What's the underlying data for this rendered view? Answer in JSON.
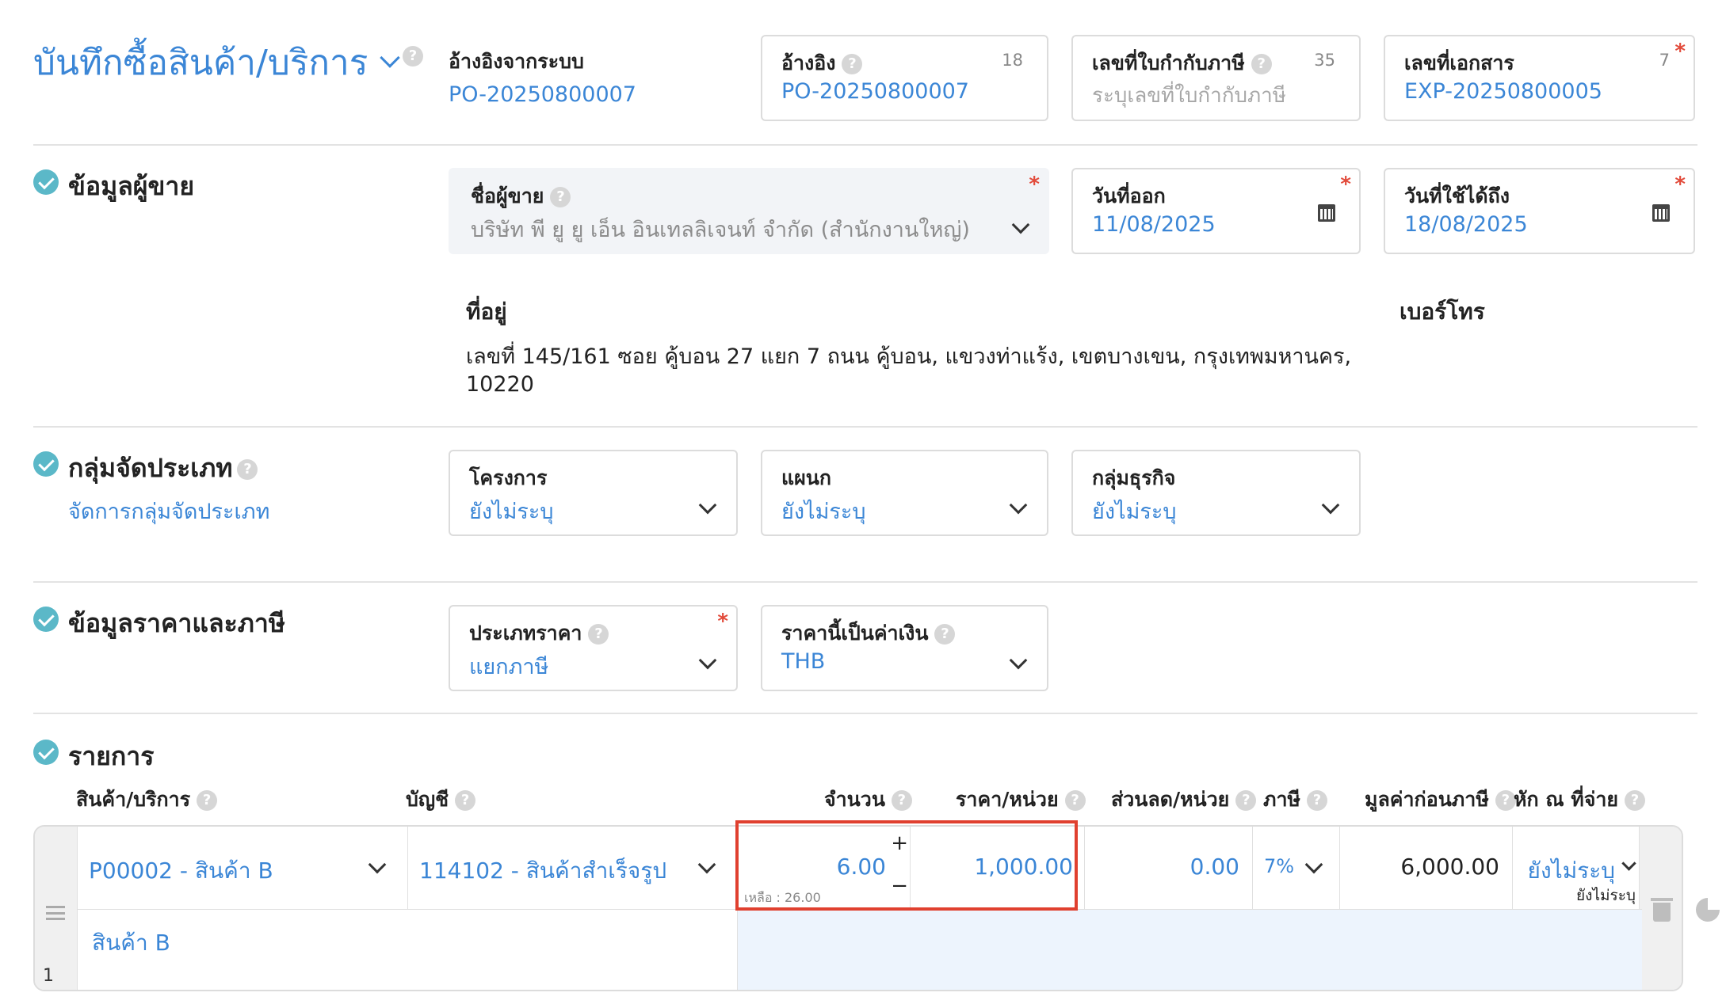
{
  "header": {
    "title": "บันทึกซื้อสินค้า/บริการ",
    "help": "?",
    "ref_system_label": "อ้างอิงจากระบบ",
    "ref_system_value": "PO-20250800007",
    "ref": {
      "label": "อ้างอิง",
      "value": "PO-20250800007",
      "count": "18"
    },
    "tax_invoice": {
      "label": "เลขที่ใบกำกับภาษี",
      "placeholder": "ระบุเลขที่ใบกำกับภาษี",
      "count": "35"
    },
    "doc_no": {
      "label": "เลขที่เอกสาร",
      "value": "EXP-20250800005",
      "count": "7",
      "required": "*"
    }
  },
  "vendor_section": {
    "title": "ข้อมูลผู้ขาย",
    "vendor_name": {
      "label": "ชื่อผู้ขาย",
      "value": "บริษัท พี ยู ยู เอ็น อินเทลลิเจนท์ จำกัด (สำนักงานใหญ่)",
      "required": "*"
    },
    "issue_date": {
      "label": "วันที่ออก",
      "value": "11/08/2025",
      "required": "*"
    },
    "valid_until": {
      "label": "วันที่ใช้ได้ถึง",
      "value": "18/08/2025",
      "required": "*"
    },
    "address_label": "ที่อยู่",
    "address_line1": "เลขที่ 145/161 ซอย คู้บอน 27 แยก 7 ถนน คู้บอน, แขวงท่าแร้ง, เขตบางเขน, กรุงเทพมหานคร,",
    "address_line2": "10220",
    "phone_label": "เบอร์โทร"
  },
  "category_section": {
    "title": "กลุ่มจัดประเภท",
    "manage_link": "จัดการกลุ่มจัดประเภท",
    "project": {
      "label": "โครงการ",
      "value": "ยังไม่ระบุ"
    },
    "department": {
      "label": "แผนก",
      "value": "ยังไม่ระบุ"
    },
    "business_group": {
      "label": "กลุ่มธุรกิจ",
      "value": "ยังไม่ระบุ"
    }
  },
  "price_section": {
    "title": "ข้อมูลราคาและภาษี",
    "price_type": {
      "label": "ประเภทราคา",
      "value": "แยกภาษี",
      "required": "*"
    },
    "currency": {
      "label": "ราคานี้เป็นค่าเงิน",
      "value": "THB"
    }
  },
  "items_section": {
    "title": "รายการ",
    "columns": {
      "product": "สินค้า/บริการ",
      "account": "บัญชี",
      "qty": "จำนวน",
      "unit_price": "ราคา/หน่วย",
      "discount": "ส่วนลด/หน่วย",
      "tax": "ภาษี",
      "pre_tax": "มูลค่าก่อนภาษี",
      "withholding": "หัก ณ ที่จ่าย"
    },
    "rows": [
      {
        "index": "1",
        "product": "P00002 - สินค้า B",
        "account": "114102 - สินค้าสำเร็จรูป",
        "qty": "6.00",
        "remaining": "เหลือ : 26.00",
        "unit_price": "1,000.00",
        "discount": "0.00",
        "tax": "7%",
        "pre_tax": "6,000.00",
        "withholding": "ยังไม่ระบุ",
        "withholding_sub": "ยังไม่ระบุ",
        "description": "สินค้า B"
      }
    ],
    "stepper_plus": "+",
    "stepper_minus": "−"
  },
  "colors": {
    "accent": "#3b86d6",
    "check": "#5bb8c8",
    "required": "#e24b3b",
    "highlight": "#e0402f",
    "description_bg": "#edf4fd"
  }
}
